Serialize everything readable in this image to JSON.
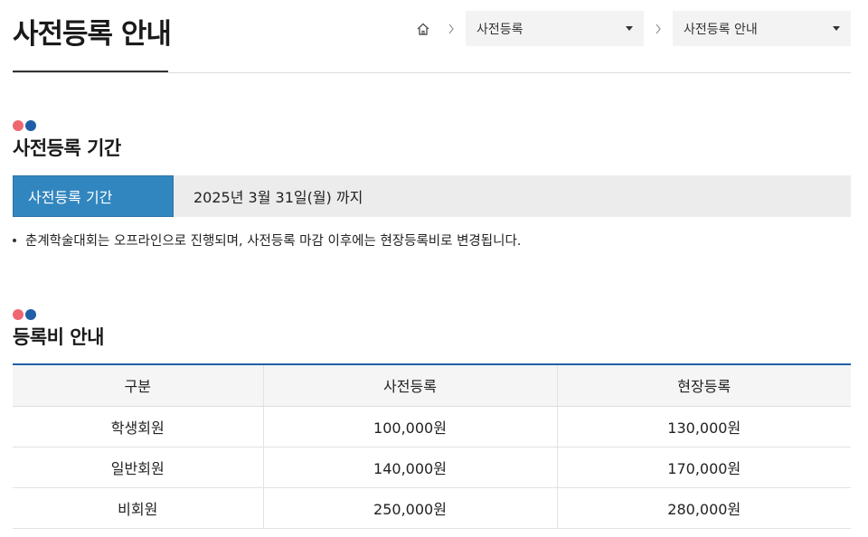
{
  "page": {
    "title": "사전등록 안내"
  },
  "breadcrumb": {
    "home_icon": "home-icon",
    "items": [
      {
        "label": "사전등록"
      },
      {
        "label": "사전등록 안내"
      }
    ]
  },
  "section_period": {
    "title": "사전등록 기간",
    "label": "사전등록 기간",
    "value": "2025년 3월 31일(월) 까지",
    "note": "춘계학술대회는 오프라인으로 진행되며, 사전등록 마감 이후에는 현장등록비로 변경됩니다."
  },
  "section_fee": {
    "title": "등록비 안내",
    "headers": [
      "구분",
      "사전등록",
      "현장등록"
    ],
    "rows": [
      [
        "학생회원",
        "100,000원",
        "130,000원"
      ],
      [
        "일반회원",
        "140,000원",
        "170,000원"
      ],
      [
        "비회원",
        "250,000원",
        "280,000원"
      ]
    ]
  },
  "colors": {
    "accent_blue": "#1f5fa8",
    "label_blue": "#3286bf",
    "dot_red": "#ee6770"
  }
}
